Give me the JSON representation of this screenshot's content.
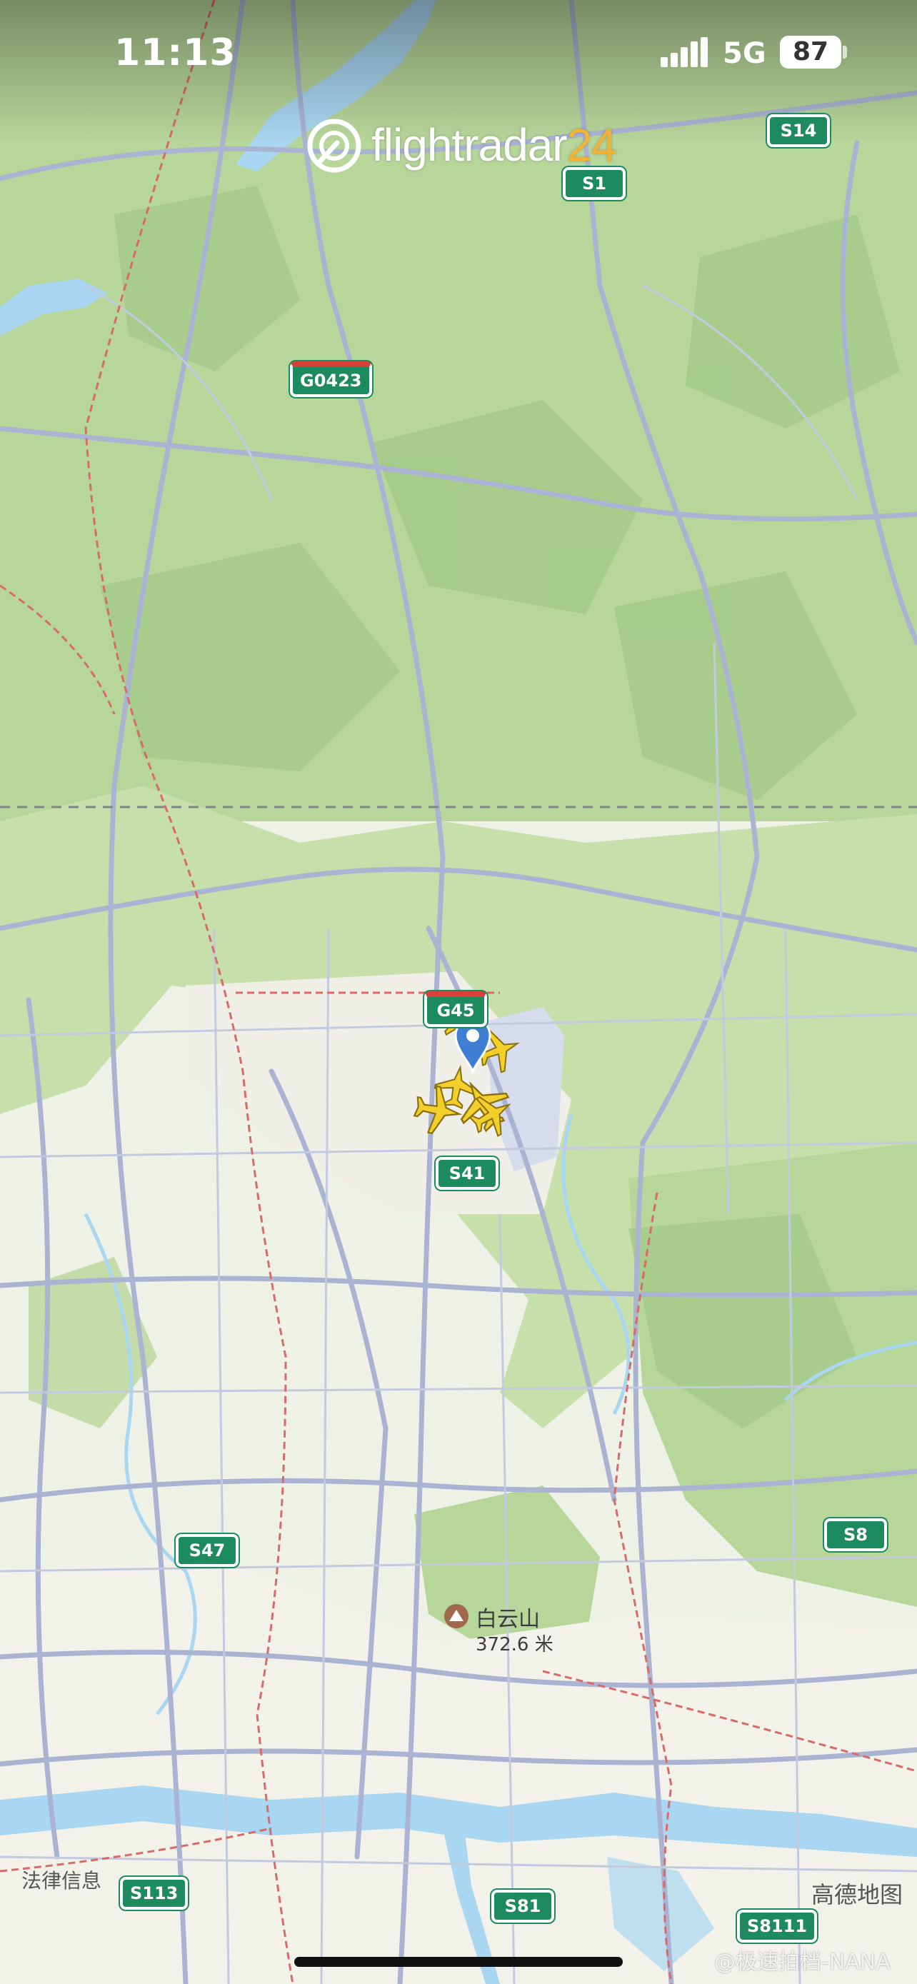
{
  "status_bar": {
    "time": "11:13",
    "network": "5G",
    "battery": "87"
  },
  "app": {
    "logo_text": "flightradar",
    "logo_number": "24"
  },
  "road_shields": [
    {
      "id": "s14",
      "label": "S14",
      "type": "provincial"
    },
    {
      "id": "s1",
      "label": "S1",
      "type": "provincial"
    },
    {
      "id": "g0423",
      "label": "G0423",
      "type": "national"
    },
    {
      "id": "g45",
      "label": "G45",
      "type": "national"
    },
    {
      "id": "s41",
      "label": "S41",
      "type": "provincial"
    },
    {
      "id": "s47",
      "label": "S47",
      "type": "provincial"
    },
    {
      "id": "s8",
      "label": "S8",
      "type": "provincial"
    },
    {
      "id": "s113",
      "label": "S113",
      "type": "provincial"
    },
    {
      "id": "s81",
      "label": "S81",
      "type": "provincial"
    },
    {
      "id": "s8111",
      "label": "S8111",
      "type": "provincial"
    }
  ],
  "poi": {
    "name": "白云山",
    "elevation": "372.6 米"
  },
  "footer": {
    "legal": "法律信息",
    "provider": "高德地图",
    "watermark": "@极速拍档-NANA"
  },
  "colors": {
    "forest": "#b9d89a",
    "urban": "#f1f1ea",
    "road": "#b3bcd6",
    "water": "#a9d6f0",
    "shield": "#1e8a5f",
    "aircraft": "#f2cf2a",
    "pin": "#3f7fd3"
  },
  "aircraft_count": 6
}
